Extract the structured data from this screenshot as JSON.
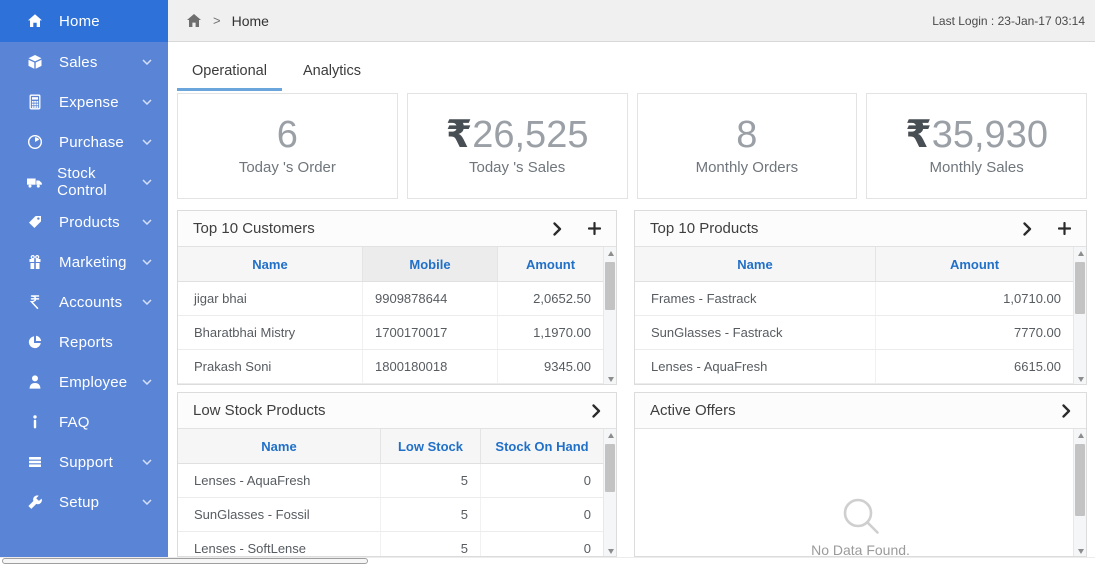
{
  "colors": {
    "sidebar_bg": "#5a85d7",
    "sidebar_active_bg": "#2e71d9",
    "table_header_blue": "#2170c8",
    "tab_underline_blue": "#6aa5dc"
  },
  "sidebar": {
    "items": [
      {
        "label": "Home",
        "icon": "home-icon",
        "active": true,
        "expandable": false
      },
      {
        "label": "Sales",
        "icon": "sales-icon",
        "active": false,
        "expandable": true
      },
      {
        "label": "Expense",
        "icon": "expense-icon",
        "active": false,
        "expandable": true
      },
      {
        "label": "Purchase",
        "icon": "purchase-icon",
        "active": false,
        "expandable": true
      },
      {
        "label": "Stock Control",
        "icon": "stock-control-icon",
        "active": false,
        "expandable": true
      },
      {
        "label": "Products",
        "icon": "products-icon",
        "active": false,
        "expandable": true
      },
      {
        "label": "Marketing",
        "icon": "marketing-icon",
        "active": false,
        "expandable": true
      },
      {
        "label": "Accounts",
        "icon": "accounts-icon",
        "active": false,
        "expandable": true
      },
      {
        "label": "Reports",
        "icon": "reports-icon",
        "active": false,
        "expandable": false
      },
      {
        "label": "Employee",
        "icon": "employee-icon",
        "active": false,
        "expandable": true
      },
      {
        "label": "FAQ",
        "icon": "faq-icon",
        "active": false,
        "expandable": false
      },
      {
        "label": "Support",
        "icon": "support-icon",
        "active": false,
        "expandable": true
      },
      {
        "label": "Setup",
        "icon": "setup-icon",
        "active": false,
        "expandable": true
      }
    ]
  },
  "topbar": {
    "breadcrumb_separator": ">",
    "breadcrumb_current": "Home",
    "last_login": "Last Login : 23-Jan-17 03:14"
  },
  "tabs": [
    {
      "label": "Operational",
      "active": true
    },
    {
      "label": "Analytics",
      "active": false
    }
  ],
  "stats": [
    {
      "currency": "",
      "value": "6",
      "label": "Today 's Order"
    },
    {
      "currency": "₹",
      "value": "26,525",
      "label": "Today 's Sales"
    },
    {
      "currency": "",
      "value": "8",
      "label": "Monthly Orders"
    },
    {
      "currency": "₹",
      "value": "35,930",
      "label": "Monthly Sales"
    }
  ],
  "panels": {
    "top_customers": {
      "title": "Top 10 Customers",
      "action_icons": [
        "chevron-right-icon",
        "plus-icon"
      ],
      "columns": [
        "Name",
        "Mobile",
        "Amount"
      ],
      "rows": [
        [
          "jigar bhai",
          "9909878644",
          "2,0652.50"
        ],
        [
          "Bharatbhai Mistry",
          "1700170017",
          "1,1970.00"
        ],
        [
          "Prakash Soni",
          "1800180018",
          "9345.00"
        ]
      ]
    },
    "top_products": {
      "title": "Top 10 Products",
      "action_icons": [
        "chevron-right-icon",
        "plus-icon"
      ],
      "columns": [
        "Name",
        "Amount"
      ],
      "rows": [
        [
          "Frames - Fastrack",
          "1,0710.00"
        ],
        [
          "SunGlasses - Fastrack",
          "7770.00"
        ],
        [
          "Lenses - AquaFresh",
          "6615.00"
        ]
      ]
    },
    "low_stock": {
      "title": "Low Stock Products",
      "action_icons": [
        "chevron-right-icon"
      ],
      "columns": [
        "Name",
        "Low Stock",
        "Stock On Hand"
      ],
      "rows": [
        [
          "Lenses - AquaFresh",
          "5",
          "0"
        ],
        [
          "SunGlasses - Fossil",
          "5",
          "0"
        ],
        [
          "Lenses - SoftLense",
          "5",
          "0"
        ]
      ]
    },
    "active_offers": {
      "title": "Active Offers",
      "action_icons": [
        "chevron-right-icon"
      ],
      "empty_icon": "magnifier-icon",
      "empty_text": "No Data Found."
    }
  }
}
